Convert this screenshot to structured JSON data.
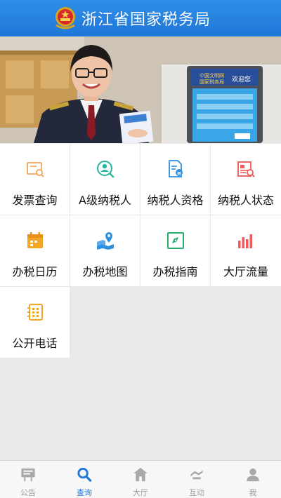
{
  "header": {
    "title": "浙江省国家税务局"
  },
  "banner": {
    "screen_line1": "中国文明网",
    "screen_line2": "国家税务局",
    "screen_welcome": "欢迎您"
  },
  "grid": {
    "items": [
      {
        "label": "发票查询",
        "icon": "invoice-search-icon",
        "color": "#f5a25a"
      },
      {
        "label": "A级纳税人",
        "icon": "a-level-taxpayer-icon",
        "color": "#29b6a0"
      },
      {
        "label": "纳税人资格",
        "icon": "taxpayer-qualification-icon",
        "color": "#2d8fe0"
      },
      {
        "label": "纳税人状态",
        "icon": "taxpayer-status-icon",
        "color": "#ef5a5a"
      },
      {
        "label": "办税日历",
        "icon": "calendar-icon",
        "color": "#f5a623"
      },
      {
        "label": "办税地图",
        "icon": "map-icon",
        "color": "#2d8fe0"
      },
      {
        "label": "办税指南",
        "icon": "guide-compass-icon",
        "color": "#2aae6d"
      },
      {
        "label": "大厅流量",
        "icon": "hall-traffic-chart-icon",
        "color": "#ef5a5a"
      },
      {
        "label": "公开电话",
        "icon": "public-phone-icon",
        "color": "#f5a623"
      }
    ]
  },
  "bottom_nav": {
    "items": [
      {
        "label": "公告",
        "icon": "announcement-icon",
        "active": false
      },
      {
        "label": "查询",
        "icon": "search-icon",
        "active": true
      },
      {
        "label": "大厅",
        "icon": "hall-icon",
        "active": false
      },
      {
        "label": "互动",
        "icon": "interaction-icon",
        "active": false
      },
      {
        "label": "我",
        "icon": "profile-icon",
        "active": false
      }
    ],
    "active_color": "#1f77d8",
    "inactive_color": "#9b9b9b"
  }
}
